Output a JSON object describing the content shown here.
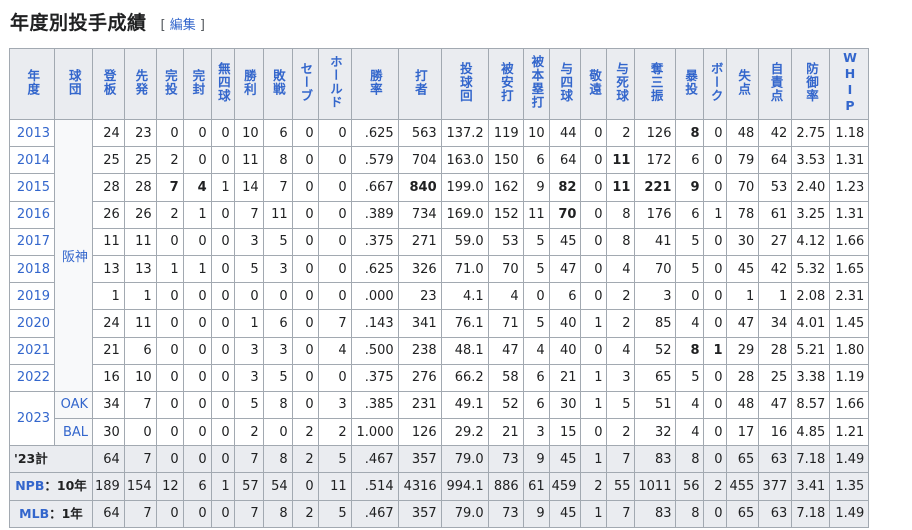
{
  "heading": {
    "title": "年度別投手成績",
    "edit_open": "[",
    "edit_label": "編集",
    "edit_close": "]"
  },
  "columns": [
    "年度",
    "球団",
    "登板",
    "先発",
    "完投",
    "完封",
    "無四球",
    "勝利",
    "敗戦",
    "セーブ",
    "ホールド",
    "勝率",
    "打者",
    "投球回",
    "被安打",
    "被本塁打",
    "与四球",
    "敬遠",
    "与死球",
    "奪三振",
    "暴投",
    "ボーク",
    "失点",
    "自責点",
    "防御率",
    "WHIP"
  ],
  "team_hanshin": "阪神",
  "team_oak": "OAK",
  "team_bal": "BAL",
  "year_2023": "2023",
  "rows_hanshin": [
    {
      "year": "2013",
      "v": [
        "24",
        "23",
        "0",
        "0",
        "0",
        "10",
        "6",
        "0",
        "0",
        ".625",
        "563",
        "137.2",
        "119",
        "10",
        "44",
        "0",
        "2",
        "126",
        "8",
        "0",
        "48",
        "42",
        "2.75",
        "1.18"
      ],
      "bold": [
        18
      ]
    },
    {
      "year": "2014",
      "v": [
        "25",
        "25",
        "2",
        "0",
        "0",
        "11",
        "8",
        "0",
        "0",
        ".579",
        "704",
        "163.0",
        "150",
        "6",
        "64",
        "0",
        "11",
        "172",
        "6",
        "0",
        "79",
        "64",
        "3.53",
        "1.31"
      ],
      "bold": [
        16
      ]
    },
    {
      "year": "2015",
      "v": [
        "28",
        "28",
        "7",
        "4",
        "1",
        "14",
        "7",
        "0",
        "0",
        ".667",
        "840",
        "199.0",
        "162",
        "9",
        "82",
        "0",
        "11",
        "221",
        "9",
        "0",
        "70",
        "53",
        "2.40",
        "1.23"
      ],
      "bold": [
        2,
        3,
        10,
        14,
        16,
        17,
        18
      ]
    },
    {
      "year": "2016",
      "v": [
        "26",
        "26",
        "2",
        "1",
        "0",
        "7",
        "11",
        "0",
        "0",
        ".389",
        "734",
        "169.0",
        "152",
        "11",
        "70",
        "0",
        "8",
        "176",
        "6",
        "1",
        "78",
        "61",
        "3.25",
        "1.31"
      ],
      "bold": [
        14
      ]
    },
    {
      "year": "2017",
      "v": [
        "11",
        "11",
        "0",
        "0",
        "0",
        "3",
        "5",
        "0",
        "0",
        ".375",
        "271",
        "59.0",
        "53",
        "5",
        "45",
        "0",
        "8",
        "41",
        "5",
        "0",
        "30",
        "27",
        "4.12",
        "1.66"
      ],
      "bold": []
    },
    {
      "year": "2018",
      "v": [
        "13",
        "13",
        "1",
        "1",
        "0",
        "5",
        "3",
        "0",
        "0",
        ".625",
        "326",
        "71.0",
        "70",
        "5",
        "47",
        "0",
        "4",
        "70",
        "5",
        "0",
        "45",
        "42",
        "5.32",
        "1.65"
      ],
      "bold": []
    },
    {
      "year": "2019",
      "v": [
        "1",
        "1",
        "0",
        "0",
        "0",
        "0",
        "0",
        "0",
        "0",
        ".000",
        "23",
        "4.1",
        "4",
        "0",
        "6",
        "0",
        "2",
        "3",
        "0",
        "0",
        "1",
        "1",
        "2.08",
        "2.31"
      ],
      "bold": []
    },
    {
      "year": "2020",
      "v": [
        "24",
        "11",
        "0",
        "0",
        "0",
        "1",
        "6",
        "0",
        "7",
        ".143",
        "341",
        "76.1",
        "71",
        "5",
        "40",
        "1",
        "2",
        "85",
        "4",
        "0",
        "47",
        "34",
        "4.01",
        "1.45"
      ],
      "bold": []
    },
    {
      "year": "2021",
      "v": [
        "21",
        "6",
        "0",
        "0",
        "0",
        "3",
        "3",
        "0",
        "4",
        ".500",
        "238",
        "48.1",
        "47",
        "4",
        "40",
        "0",
        "4",
        "52",
        "8",
        "1",
        "29",
        "28",
        "5.21",
        "1.80"
      ],
      "bold": [
        18,
        19
      ]
    },
    {
      "year": "2022",
      "v": [
        "16",
        "10",
        "0",
        "0",
        "0",
        "3",
        "5",
        "0",
        "0",
        ".375",
        "276",
        "66.2",
        "58",
        "6",
        "21",
        "1",
        "3",
        "65",
        "5",
        "0",
        "28",
        "25",
        "3.38",
        "1.19"
      ],
      "bold": []
    }
  ],
  "row_oak": {
    "v": [
      "34",
      "7",
      "0",
      "0",
      "0",
      "5",
      "8",
      "0",
      "3",
      ".385",
      "231",
      "49.1",
      "52",
      "6",
      "30",
      "1",
      "5",
      "51",
      "4",
      "0",
      "48",
      "47",
      "8.57",
      "1.66"
    ]
  },
  "row_bal": {
    "v": [
      "30",
      "0",
      "0",
      "0",
      "0",
      "2",
      "0",
      "2",
      "2",
      "1.000",
      "126",
      "29.2",
      "21",
      "3",
      "15",
      "0",
      "2",
      "32",
      "4",
      "0",
      "17",
      "16",
      "4.85",
      "1.21"
    ]
  },
  "row_23total": {
    "label": "'23計",
    "v": [
      "64",
      "7",
      "0",
      "0",
      "0",
      "7",
      "8",
      "2",
      "5",
      ".467",
      "357",
      "79.0",
      "73",
      "9",
      "45",
      "1",
      "7",
      "83",
      "8",
      "0",
      "65",
      "63",
      "7.18",
      "1.49"
    ]
  },
  "row_npb": {
    "label_link": "NPB",
    "label_rest": "：10年",
    "v": [
      "189",
      "154",
      "12",
      "6",
      "1",
      "57",
      "54",
      "0",
      "11",
      ".514",
      "4316",
      "994.1",
      "886",
      "61",
      "459",
      "2",
      "55",
      "1011",
      "56",
      "2",
      "455",
      "377",
      "3.41",
      "1.35"
    ]
  },
  "row_mlb": {
    "label_link": "MLB",
    "label_rest": "：1年",
    "v": [
      "64",
      "7",
      "0",
      "0",
      "0",
      "7",
      "8",
      "2",
      "5",
      ".467",
      "357",
      "79.0",
      "73",
      "9",
      "45",
      "1",
      "7",
      "83",
      "8",
      "0",
      "65",
      "63",
      "7.18",
      "1.49"
    ]
  }
}
